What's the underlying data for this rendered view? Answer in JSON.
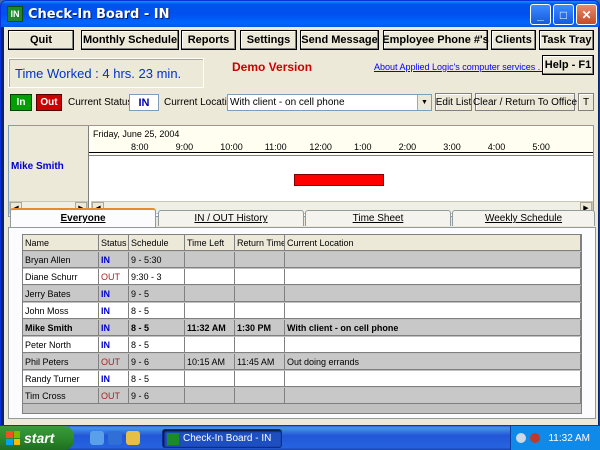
{
  "window": {
    "title": "Check-In Board - IN",
    "icon_text": "IN"
  },
  "toolbar": {
    "quit": "Quit",
    "monthly": "Monthly Schedule",
    "reports": "Reports",
    "settings": "Settings",
    "send_message": "Send Message",
    "employee_phone": "Employee Phone #'s",
    "clients": "Clients",
    "task_tray": "Task Tray"
  },
  "info": {
    "time_worked": "Time Worked :  4 hrs.  23 min.",
    "demo": "Demo Version",
    "about": "About Applied Logic's computer services . . .",
    "help": "Help - F1"
  },
  "status_bar": {
    "in_label": "In",
    "out_label": "Out",
    "current_status_label": "Current Status:",
    "current_status": "IN",
    "current_location_label": "Current Location:",
    "current_location": "With client - on cell phone",
    "edit_list": "Edit List",
    "clear_return": "Clear / Return To Office",
    "t_button": "T"
  },
  "timeline": {
    "date": "Friday, June 25, 2004",
    "ticks": [
      "8:00",
      "9:00",
      "10:00",
      "11:00",
      "12:00",
      "1:00",
      "2:00",
      "3:00",
      "4:00",
      "5:00"
    ],
    "employee": "Mike Smith",
    "bar_color": "#ff0000"
  },
  "tabs": [
    "Everyone",
    "IN / OUT History",
    "Time Sheet",
    "Weekly Schedule"
  ],
  "grid": {
    "columns": [
      "Name",
      "Status",
      "Schedule",
      "Time Left",
      "Return Time",
      "Current Location"
    ],
    "rows": [
      [
        "Bryan Allen",
        "IN",
        "9 - 5:30",
        "",
        "",
        ""
      ],
      [
        "Diane Schurr",
        "OUT",
        "9:30 - 3",
        "",
        "",
        ""
      ],
      [
        "Jerry Bates",
        "IN",
        "9 - 5",
        "",
        "",
        ""
      ],
      [
        "John Moss",
        "IN",
        "8 - 5",
        "",
        "",
        ""
      ],
      [
        "Mike Smith",
        "IN",
        "8 - 5",
        "11:32 AM",
        "1:30 PM",
        "With client - on cell phone"
      ],
      [
        "Peter North",
        "IN",
        "8 - 5",
        "",
        "",
        ""
      ],
      [
        "Phil Peters",
        "OUT",
        "9 - 6",
        "10:15 AM",
        "11:45 AM",
        "Out doing errands"
      ],
      [
        "Randy Turner",
        "IN",
        "8 - 5",
        "",
        "",
        ""
      ],
      [
        "Tim Cross",
        "OUT",
        "9 - 6",
        "",
        "",
        ""
      ]
    ]
  },
  "taskbar": {
    "start": "start",
    "task": "Check-In Board - IN",
    "clock": "11:32 AM"
  },
  "colors": {
    "status_in": "#0000cc",
    "status_out": "#aa2222",
    "demo": "#cc0000",
    "title_bar": "#0050ee"
  }
}
